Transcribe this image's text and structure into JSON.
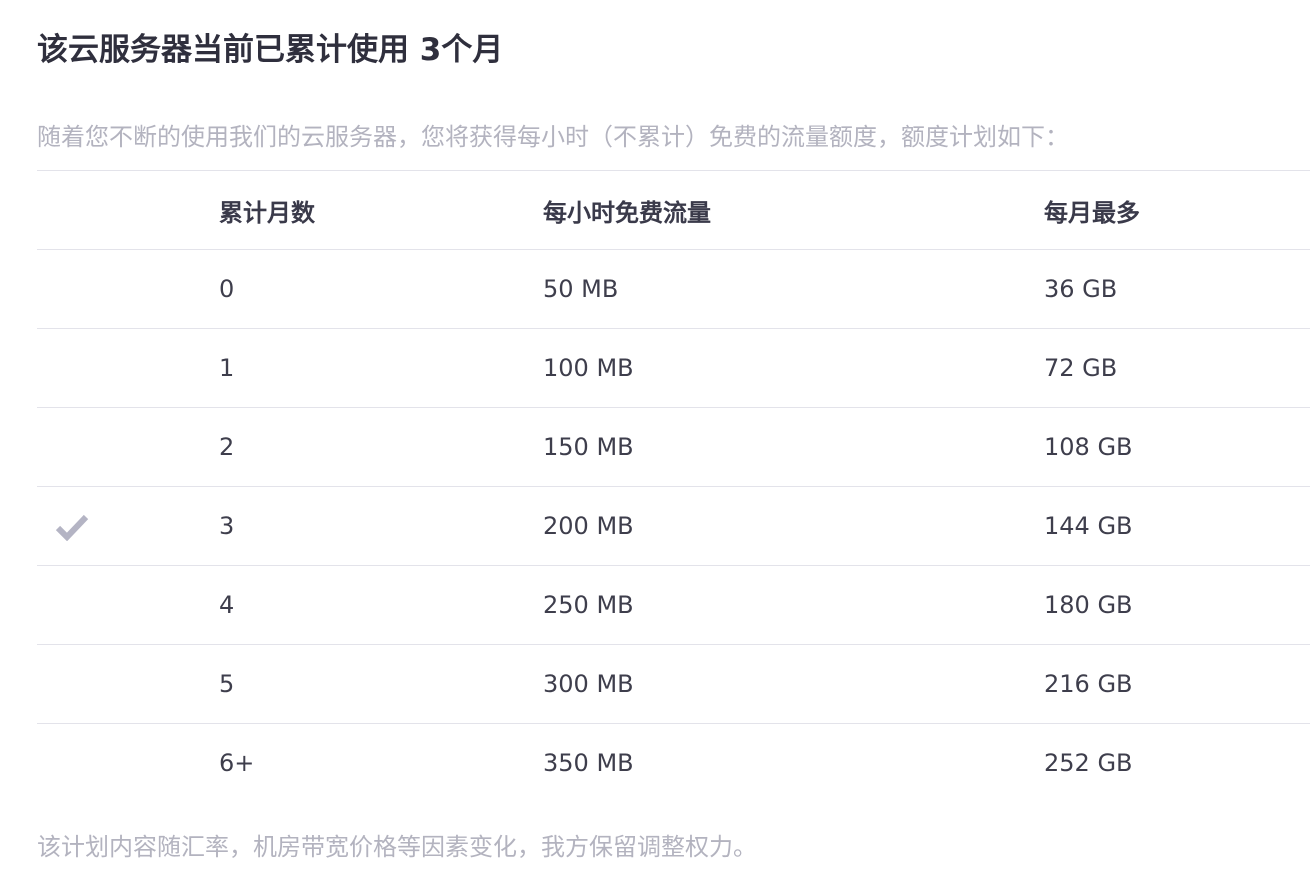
{
  "header": {
    "title": "该云服务器当前已累计使用 3个月"
  },
  "intro": {
    "text": "随着您不断的使用我们的云服务器，您将获得每小时（不累计）免费的流量额度，额度计划如下："
  },
  "table": {
    "columns": {
      "months": "累计月数",
      "hourly": "每小时免费流量",
      "monthly": "每月最多"
    },
    "rows": [
      {
        "months": "0",
        "hourly": "50 MB",
        "monthly": "36 GB",
        "current": false
      },
      {
        "months": "1",
        "hourly": "100 MB",
        "monthly": "72 GB",
        "current": false
      },
      {
        "months": "2",
        "hourly": "150 MB",
        "monthly": "108 GB",
        "current": false
      },
      {
        "months": "3",
        "hourly": "200 MB",
        "monthly": "144 GB",
        "current": true
      },
      {
        "months": "4",
        "hourly": "250 MB",
        "monthly": "180 GB",
        "current": false
      },
      {
        "months": "5",
        "hourly": "300 MB",
        "monthly": "216 GB",
        "current": false
      },
      {
        "months": "6+",
        "hourly": "350 MB",
        "monthly": "252 GB",
        "current": false
      }
    ],
    "current_icon": "check-icon",
    "icon_color": "#b4b4c4"
  },
  "footer": {
    "note": "该计划内容随汇率，机房带宽价格等因素变化，我方保留调整权力。"
  }
}
